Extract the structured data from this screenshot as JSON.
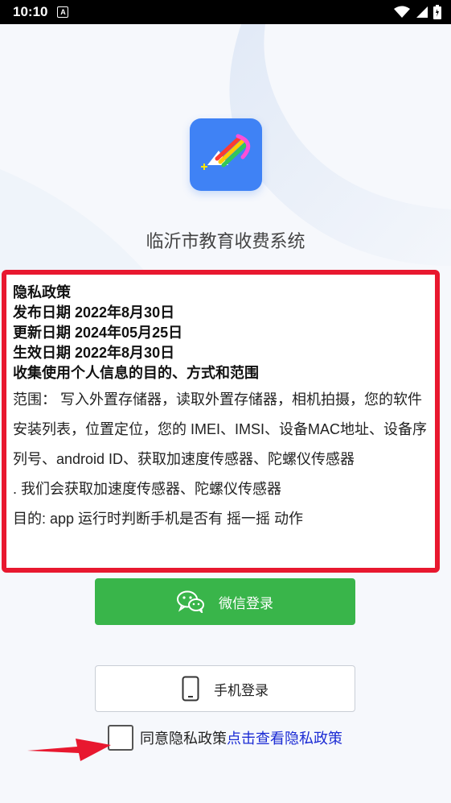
{
  "status_bar": {
    "time": "10:10",
    "notification_icon": "A",
    "icons": [
      "wifi-icon",
      "signal-icon",
      "battery-icon"
    ]
  },
  "app": {
    "title": "临沂市教育收费系统"
  },
  "policy": {
    "title": "隐私政策",
    "publish_date": "发布日期 2022年8月30日",
    "update_date": "更新日期 2024年05月25日",
    "effective_date": "生效日期 2022年8月30日",
    "purpose_heading": "收集使用个人信息的目的、方式和范围",
    "scope_text": "范围： 写入外置存储器，读取外置存储器，相机拍摄，您的软件安装列表，位置定位，您的 IMEI、IMSI、设备MAC地址、设备序列号、android ID、获取加速度传感器、陀螺仪传感器",
    "sensor_text": ". 我们会获取加速度传感器、陀螺仪传感器",
    "goal_text": "目的: app 运行时判断手机是否有 摇一摇 动作"
  },
  "buttons": {
    "wechat_login": "微信登录",
    "phone_login": "手机登录"
  },
  "agreement": {
    "label": "同意隐私政策",
    "link": "点击查看隐私政策",
    "checked": false
  },
  "colors": {
    "highlight_border": "#e8182f",
    "wechat_green": "#39b54a",
    "logo_blue": "#3f82f5",
    "link_blue": "#1b2bd4"
  }
}
